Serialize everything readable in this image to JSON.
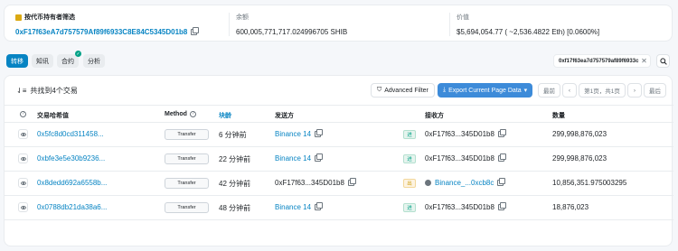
{
  "filter": {
    "label": "按代币持有者筛选",
    "address": "0xF17f63eA7d757579Af89f6933C8E84C5345D01b8",
    "balance_label": "余额",
    "balance_value": "600,005,771,717.024996705 SHIB",
    "value_label": "价值",
    "value_value": "$5,694,054.77 ( ~2,536.4822 Eth) [0.0600%]"
  },
  "tabs": [
    {
      "label": "转移",
      "active": true
    },
    {
      "label": "知讯",
      "active": false
    },
    {
      "label": "合约",
      "active": false,
      "verified": true
    },
    {
      "label": "分析",
      "active": false
    }
  ],
  "address_filter": "0xf17f63ea7d757579af89f6933c",
  "icons": {
    "close": "close-icon",
    "search": "search-icon"
  },
  "toolbar": {
    "found_text": "共找到4个交易",
    "advanced_filter": "Advanced Filter",
    "export": "Export Current Page Data",
    "first": "最前",
    "page_info": "第1页，共1页",
    "last": "最后"
  },
  "columns": {
    "hash": "交易哈希值",
    "method": "Method",
    "block": "块龄",
    "from": "发送方",
    "to": "接收方",
    "amount": "数量"
  },
  "rows": [
    {
      "hash": "0x5fc8d0cd311458...",
      "method": "Transfer",
      "age": "6 分钟前",
      "from": "Binance 14",
      "direction": "进",
      "to": "0xF17f63...345D01b8",
      "amount": "299,998,876,023"
    },
    {
      "hash": "0xbfe3e5e30b9236...",
      "method": "Transfer",
      "age": "22 分钟前",
      "from": "Binance 14",
      "direction": "进",
      "to": "0xF17f63...345D01b8",
      "amount": "299,998,876,023"
    },
    {
      "hash": "0x8dedd692a6558b...",
      "method": "Transfer",
      "age": "42 分钟前",
      "from": "0xF17f63...345D01b8",
      "direction": "出",
      "to": "Binance_...0xcb8c",
      "amount": "10,856,351.975003295"
    },
    {
      "hash": "0x0788db21da38a6...",
      "method": "Transfer",
      "age": "48 分钟前",
      "from": "Binance 14",
      "direction": "进",
      "to": "0xF17f63...345D01b8",
      "amount": "18,876,023"
    }
  ],
  "colors": {
    "accent": "#0784c3",
    "in": "#00a186",
    "out": "#cc9a06"
  }
}
